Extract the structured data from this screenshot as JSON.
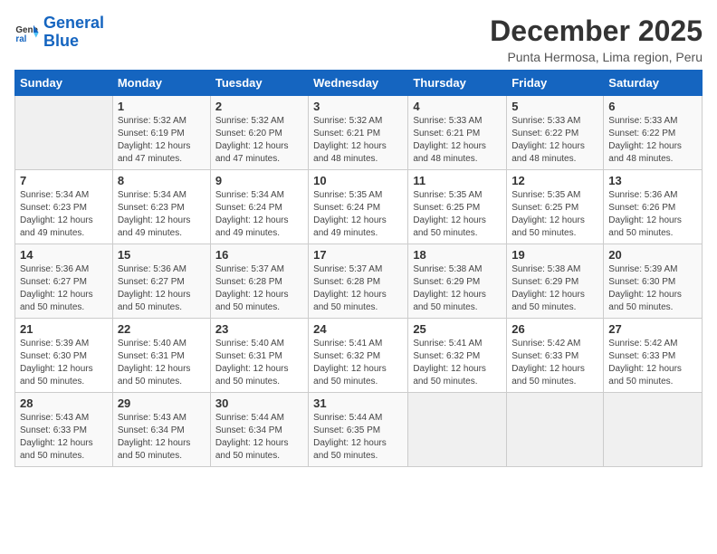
{
  "logo": {
    "line1": "General",
    "line2": "Blue"
  },
  "title": "December 2025",
  "subtitle": "Punta Hermosa, Lima region, Peru",
  "days_of_week": [
    "Sunday",
    "Monday",
    "Tuesday",
    "Wednesday",
    "Thursday",
    "Friday",
    "Saturday"
  ],
  "weeks": [
    [
      {
        "day": "",
        "info": ""
      },
      {
        "day": "1",
        "info": "Sunrise: 5:32 AM\nSunset: 6:19 PM\nDaylight: 12 hours\nand 47 minutes."
      },
      {
        "day": "2",
        "info": "Sunrise: 5:32 AM\nSunset: 6:20 PM\nDaylight: 12 hours\nand 47 minutes."
      },
      {
        "day": "3",
        "info": "Sunrise: 5:32 AM\nSunset: 6:21 PM\nDaylight: 12 hours\nand 48 minutes."
      },
      {
        "day": "4",
        "info": "Sunrise: 5:33 AM\nSunset: 6:21 PM\nDaylight: 12 hours\nand 48 minutes."
      },
      {
        "day": "5",
        "info": "Sunrise: 5:33 AM\nSunset: 6:22 PM\nDaylight: 12 hours\nand 48 minutes."
      },
      {
        "day": "6",
        "info": "Sunrise: 5:33 AM\nSunset: 6:22 PM\nDaylight: 12 hours\nand 48 minutes."
      }
    ],
    [
      {
        "day": "7",
        "info": "Sunrise: 5:34 AM\nSunset: 6:23 PM\nDaylight: 12 hours\nand 49 minutes."
      },
      {
        "day": "8",
        "info": "Sunrise: 5:34 AM\nSunset: 6:23 PM\nDaylight: 12 hours\nand 49 minutes."
      },
      {
        "day": "9",
        "info": "Sunrise: 5:34 AM\nSunset: 6:24 PM\nDaylight: 12 hours\nand 49 minutes."
      },
      {
        "day": "10",
        "info": "Sunrise: 5:35 AM\nSunset: 6:24 PM\nDaylight: 12 hours\nand 49 minutes."
      },
      {
        "day": "11",
        "info": "Sunrise: 5:35 AM\nSunset: 6:25 PM\nDaylight: 12 hours\nand 50 minutes."
      },
      {
        "day": "12",
        "info": "Sunrise: 5:35 AM\nSunset: 6:25 PM\nDaylight: 12 hours\nand 50 minutes."
      },
      {
        "day": "13",
        "info": "Sunrise: 5:36 AM\nSunset: 6:26 PM\nDaylight: 12 hours\nand 50 minutes."
      }
    ],
    [
      {
        "day": "14",
        "info": "Sunrise: 5:36 AM\nSunset: 6:27 PM\nDaylight: 12 hours\nand 50 minutes."
      },
      {
        "day": "15",
        "info": "Sunrise: 5:36 AM\nSunset: 6:27 PM\nDaylight: 12 hours\nand 50 minutes."
      },
      {
        "day": "16",
        "info": "Sunrise: 5:37 AM\nSunset: 6:28 PM\nDaylight: 12 hours\nand 50 minutes."
      },
      {
        "day": "17",
        "info": "Sunrise: 5:37 AM\nSunset: 6:28 PM\nDaylight: 12 hours\nand 50 minutes."
      },
      {
        "day": "18",
        "info": "Sunrise: 5:38 AM\nSunset: 6:29 PM\nDaylight: 12 hours\nand 50 minutes."
      },
      {
        "day": "19",
        "info": "Sunrise: 5:38 AM\nSunset: 6:29 PM\nDaylight: 12 hours\nand 50 minutes."
      },
      {
        "day": "20",
        "info": "Sunrise: 5:39 AM\nSunset: 6:30 PM\nDaylight: 12 hours\nand 50 minutes."
      }
    ],
    [
      {
        "day": "21",
        "info": "Sunrise: 5:39 AM\nSunset: 6:30 PM\nDaylight: 12 hours\nand 50 minutes."
      },
      {
        "day": "22",
        "info": "Sunrise: 5:40 AM\nSunset: 6:31 PM\nDaylight: 12 hours\nand 50 minutes."
      },
      {
        "day": "23",
        "info": "Sunrise: 5:40 AM\nSunset: 6:31 PM\nDaylight: 12 hours\nand 50 minutes."
      },
      {
        "day": "24",
        "info": "Sunrise: 5:41 AM\nSunset: 6:32 PM\nDaylight: 12 hours\nand 50 minutes."
      },
      {
        "day": "25",
        "info": "Sunrise: 5:41 AM\nSunset: 6:32 PM\nDaylight: 12 hours\nand 50 minutes."
      },
      {
        "day": "26",
        "info": "Sunrise: 5:42 AM\nSunset: 6:33 PM\nDaylight: 12 hours\nand 50 minutes."
      },
      {
        "day": "27",
        "info": "Sunrise: 5:42 AM\nSunset: 6:33 PM\nDaylight: 12 hours\nand 50 minutes."
      }
    ],
    [
      {
        "day": "28",
        "info": "Sunrise: 5:43 AM\nSunset: 6:33 PM\nDaylight: 12 hours\nand 50 minutes."
      },
      {
        "day": "29",
        "info": "Sunrise: 5:43 AM\nSunset: 6:34 PM\nDaylight: 12 hours\nand 50 minutes."
      },
      {
        "day": "30",
        "info": "Sunrise: 5:44 AM\nSunset: 6:34 PM\nDaylight: 12 hours\nand 50 minutes."
      },
      {
        "day": "31",
        "info": "Sunrise: 5:44 AM\nSunset: 6:35 PM\nDaylight: 12 hours\nand 50 minutes."
      },
      {
        "day": "",
        "info": ""
      },
      {
        "day": "",
        "info": ""
      },
      {
        "day": "",
        "info": ""
      }
    ]
  ]
}
